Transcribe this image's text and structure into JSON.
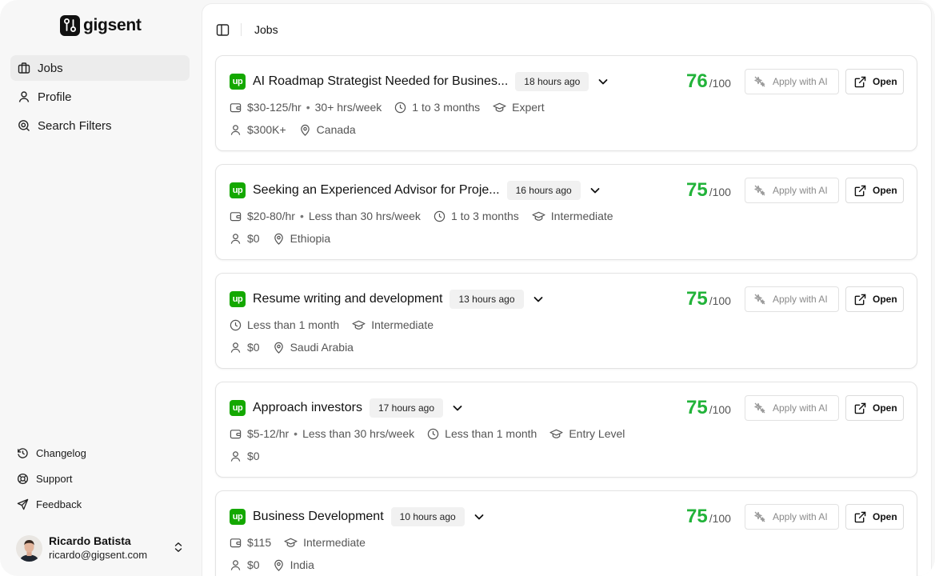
{
  "brand": {
    "name": "gigsent"
  },
  "sidebar": {
    "items": [
      {
        "label": "Jobs",
        "icon": "briefcase-icon",
        "active": true
      },
      {
        "label": "Profile",
        "icon": "user-icon"
      },
      {
        "label": "Search Filters",
        "icon": "search-icon"
      }
    ],
    "footer": [
      {
        "label": "Changelog",
        "icon": "history-icon"
      },
      {
        "label": "Support",
        "icon": "lifebuoy-icon"
      },
      {
        "label": "Feedback",
        "icon": "send-icon"
      }
    ],
    "user": {
      "name": "Ricardo Batista",
      "email": "ricardo@gigsent.com"
    }
  },
  "header": {
    "title": "Jobs"
  },
  "card_labels": {
    "score_denominator": "/100",
    "apply": "Apply with AI",
    "open": "Open",
    "platform_badge": "up"
  },
  "jobs": [
    {
      "title": "AI Roadmap Strategist Needed for Busines...",
      "age": "18 hours ago",
      "score": "76",
      "rate": "$30-125/hr",
      "hours": "30+ hrs/week",
      "duration": "1 to 3 months",
      "level": "Expert",
      "spent": "$300K+",
      "location": "Canada"
    },
    {
      "title": "Seeking an Experienced Advisor for Proje...",
      "age": "16 hours ago",
      "score": "75",
      "rate": "$20-80/hr",
      "hours": "Less than 30 hrs/week",
      "duration": "1 to 3 months",
      "level": "Intermediate",
      "spent": "$0",
      "location": "Ethiopia"
    },
    {
      "title": "Resume writing and development",
      "age": "13 hours ago",
      "score": "75",
      "rate": null,
      "hours": null,
      "duration": "Less than 1 month",
      "level": "Intermediate",
      "spent": "$0",
      "location": "Saudi Arabia"
    },
    {
      "title": "Approach investors",
      "age": "17 hours ago",
      "score": "75",
      "rate": "$5-12/hr",
      "hours": "Less than 30 hrs/week",
      "duration": "Less than 1 month",
      "level": "Entry Level",
      "spent": "$0",
      "location": null
    },
    {
      "title": "Business Development",
      "age": "10 hours ago",
      "score": "75",
      "rate": "$115",
      "hours": null,
      "duration": null,
      "level": "Intermediate",
      "spent": "$0",
      "location": "India"
    }
  ],
  "colors": {
    "accent_green": "#22b33a",
    "platform_green": "#14a800"
  }
}
